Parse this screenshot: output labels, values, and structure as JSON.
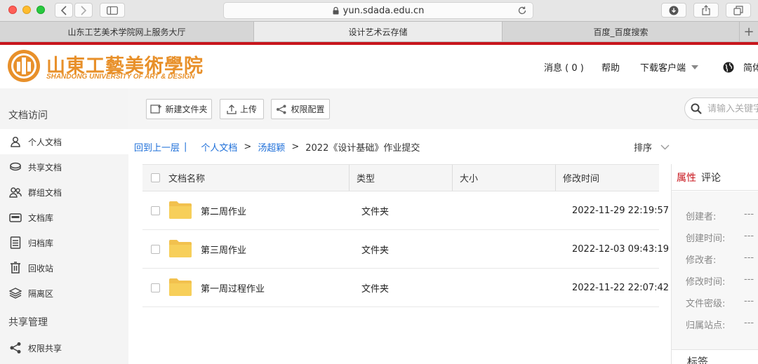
{
  "browser": {
    "url": "yun.sdada.edu.cn",
    "tabs": [
      {
        "label": "山东工艺美术学院网上服务大厅",
        "active": false
      },
      {
        "label": "设计艺术云存储",
        "active": true
      },
      {
        "label": "百度_百度搜索",
        "active": false
      }
    ],
    "new_tab": "+"
  },
  "header": {
    "logo_cn": "山東工藝美術學院",
    "logo_en": "SHANDONG UNIVERSITY OF ART & DESIGN",
    "messages": "消息 ( 0 )",
    "help": "帮助",
    "download_client": "下载客户端",
    "language": "简体"
  },
  "sidebar": {
    "section_docs": "文档访问",
    "items": [
      {
        "label": "个人文档",
        "icon": "person-icon",
        "active": true
      },
      {
        "label": "共享文档",
        "icon": "shared-docs-icon",
        "active": false
      },
      {
        "label": "群组文档",
        "icon": "group-icon",
        "active": false
      },
      {
        "label": "文档库",
        "icon": "library-icon",
        "active": false
      },
      {
        "label": "归档库",
        "icon": "archive-icon",
        "active": false
      },
      {
        "label": "回收站",
        "icon": "trash-icon",
        "active": false
      },
      {
        "label": "隔离区",
        "icon": "quarantine-icon",
        "active": false
      }
    ],
    "section_share": "共享管理",
    "share_items": [
      {
        "label": "权限共享",
        "icon": "share-icon"
      }
    ]
  },
  "toolbar": {
    "new_folder": "新建文件夹",
    "upload": "上传",
    "permissions": "权限配置",
    "search_placeholder": "请输入关键字"
  },
  "breadcrumb": {
    "back": "回到上一层",
    "divider": "|",
    "sep": ">",
    "items": [
      "个人文档",
      "汤超颖"
    ],
    "current": "2022《设计基础》作业提交"
  },
  "sort_label": "排序",
  "table": {
    "columns": {
      "name": "文档名称",
      "type": "类型",
      "size": "大小",
      "modified": "修改时间"
    },
    "rows": [
      {
        "name": "第二周作业",
        "type": "文件夹",
        "size": "",
        "modified": "2022-11-29 22:19:57"
      },
      {
        "name": "第三周作业",
        "type": "文件夹",
        "size": "",
        "modified": "2022-12-03 09:43:19"
      },
      {
        "name": "第一周过程作业",
        "type": "文件夹",
        "size": "",
        "modified": "2022-11-22 22:07:42"
      }
    ]
  },
  "properties": {
    "tab_properties": "属性",
    "tab_comments": "评论",
    "fields": [
      {
        "label": "创建者:",
        "value": "---"
      },
      {
        "label": "创建时间:",
        "value": "---"
      },
      {
        "label": "修改者:",
        "value": "---"
      },
      {
        "label": "修改时间:",
        "value": "---"
      },
      {
        "label": "文件密级:",
        "value": "---"
      },
      {
        "label": "归属站点:",
        "value": "---"
      }
    ],
    "tags": "标签"
  },
  "colors": {
    "accent_red": "#c8161d",
    "link_blue": "#1e6fd9",
    "logo_orange": "#e8902a",
    "folder_yellow": "#f7cf5a"
  }
}
